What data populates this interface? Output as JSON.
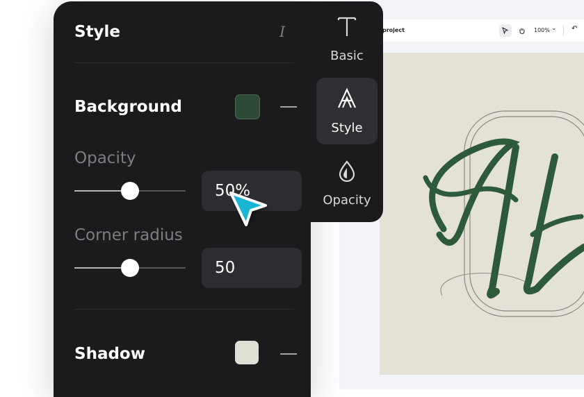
{
  "canvas_app": {
    "project_name": "project",
    "zoom": "100%",
    "zoom_chevron": "⌄",
    "undo_glyph": "↶"
  },
  "style_panel": {
    "title": "Style",
    "italic_glyph": "I",
    "background": {
      "label": "Background",
      "swatch_color": "#2d4a36"
    },
    "opacity": {
      "label": "Opacity",
      "value": "50%",
      "slider_fraction": 0.5
    },
    "corner_radius": {
      "label": "Corner radius",
      "value": "50",
      "slider_fraction": 0.5
    },
    "shadow": {
      "label": "Shadow",
      "swatch_color": "#e0dfd3"
    }
  },
  "tab_rail": {
    "tabs": [
      {
        "label": "Basic",
        "icon": "text-icon",
        "active": false
      },
      {
        "label": "Style",
        "icon": "style-a-icon",
        "active": true
      },
      {
        "label": "Opacity",
        "icon": "drop-icon",
        "active": false
      }
    ]
  },
  "colors": {
    "panel_bg": "#1b1b1d",
    "accent_cursor": "#16b6d4",
    "artwork_green": "#2e5a3c",
    "artboard_bg": "#e4e2d6"
  }
}
